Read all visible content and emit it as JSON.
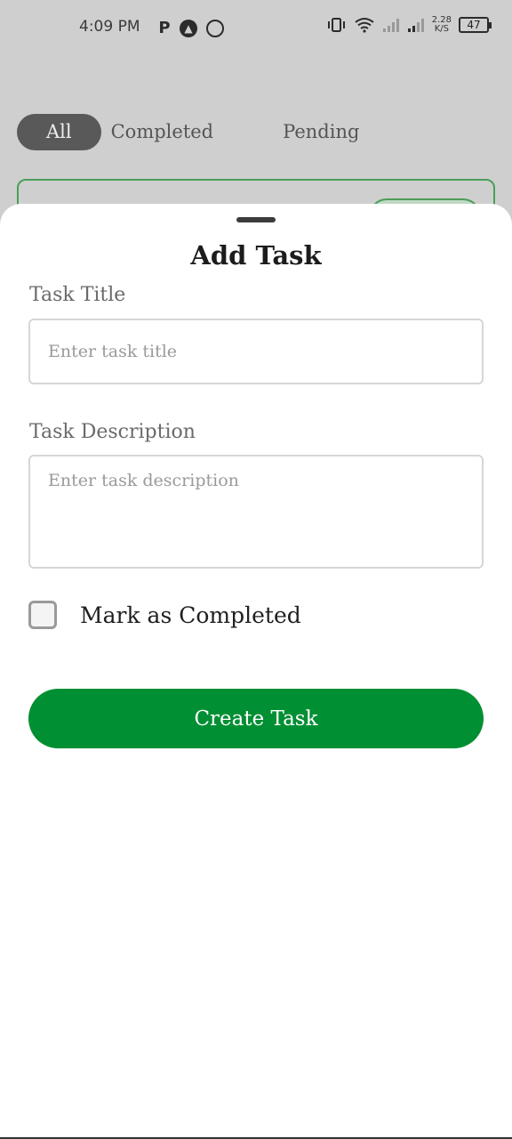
{
  "status_bar": {
    "time": "4:09 PM",
    "app_icons": [
      "paytm-icon",
      "notification-app-icon",
      "whatsapp-icon"
    ],
    "net_speed_value": "2.28",
    "net_speed_unit": "K/S",
    "battery": "47"
  },
  "filter_tabs": {
    "all": "All",
    "completed": "Completed",
    "pending": "Pending",
    "active": "All"
  },
  "sheet": {
    "title": "Add Task",
    "task_title_label": "Task Title",
    "task_title_placeholder": "Enter task title",
    "task_title_value": "",
    "task_description_label": "Task Description",
    "task_description_placeholder": "Enter task description",
    "task_description_value": "",
    "mark_completed_label": "Mark as Completed",
    "mark_completed_checked": false,
    "create_button_label": "Create Task"
  },
  "colors": {
    "primary_green": "#008f33",
    "card_border_green": "#4a9e5a",
    "active_tab_bg": "#595959"
  }
}
